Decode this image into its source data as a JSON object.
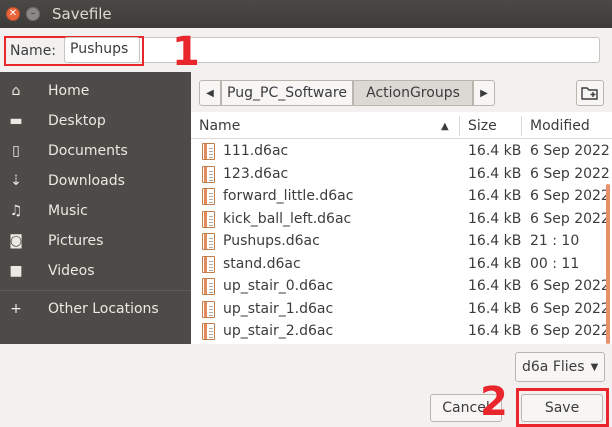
{
  "window": {
    "title": "Savefile"
  },
  "name_row": {
    "label": "Name:",
    "value": "Pushups"
  },
  "annotations": {
    "one": "1",
    "two": "2"
  },
  "sidebar": {
    "items": [
      {
        "label": "Home",
        "icon": "home-icon"
      },
      {
        "label": "Desktop",
        "icon": "folder-icon"
      },
      {
        "label": "Documents",
        "icon": "document-icon"
      },
      {
        "label": "Downloads",
        "icon": "download-icon"
      },
      {
        "label": "Music",
        "icon": "music-icon"
      },
      {
        "label": "Pictures",
        "icon": "camera-icon"
      },
      {
        "label": "Videos",
        "icon": "video-icon"
      },
      {
        "label": "Other Locations",
        "icon": "plus-icon"
      }
    ]
  },
  "path": {
    "segments": [
      "Pug_PC_Software",
      "ActionGroups"
    ]
  },
  "file_list": {
    "columns": {
      "name": "Name",
      "size": "Size",
      "modified": "Modified"
    },
    "rows": [
      {
        "name": "111.d6ac",
        "size": "16.4 kB",
        "modified": "6 Sep 2022"
      },
      {
        "name": "123.d6ac",
        "size": "16.4 kB",
        "modified": "6 Sep 2022"
      },
      {
        "name": "forward_little.d6ac",
        "size": "16.4 kB",
        "modified": "6 Sep 2022"
      },
      {
        "name": "kick_ball_left.d6ac",
        "size": "16.4 kB",
        "modified": "6 Sep 2022"
      },
      {
        "name": "Pushups.d6ac",
        "size": "16.4 kB",
        "modified": "21 : 10"
      },
      {
        "name": "stand.d6ac",
        "size": "16.4 kB",
        "modified": "00 : 11"
      },
      {
        "name": "up_stair_0.d6ac",
        "size": "16.4 kB",
        "modified": "6 Sep 2022"
      },
      {
        "name": "up_stair_1.d6ac",
        "size": "16.4 kB",
        "modified": "6 Sep 2022"
      },
      {
        "name": "up_stair_2.d6ac",
        "size": "16.4 kB",
        "modified": "6 Sep 2022"
      }
    ]
  },
  "filter": {
    "label": "d6a Flies"
  },
  "buttons": {
    "cancel": "Cancel",
    "save": "Save"
  },
  "colors": {
    "annotation": "#e8262b",
    "sidebar": "#4d4b47",
    "accent": "#e9643a"
  }
}
